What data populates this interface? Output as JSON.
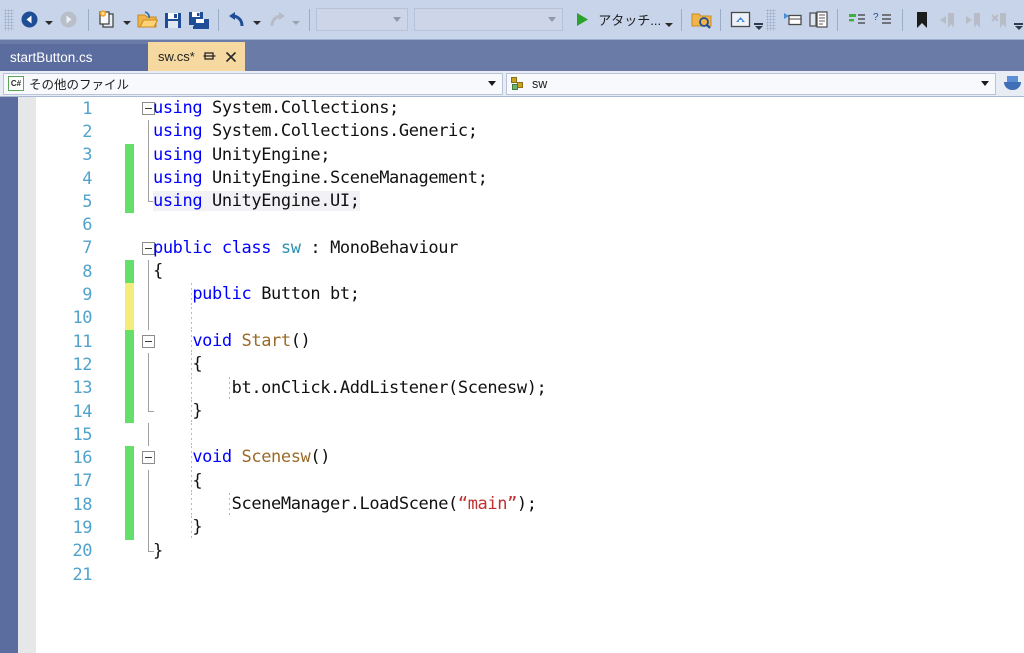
{
  "toolbar": {
    "items": [
      {
        "name": "navigate-backward-icon",
        "label": "",
        "enabled": true
      },
      {
        "name": "navigate-forward-icon",
        "label": "",
        "enabled": false
      },
      {
        "name": "new-item-icon",
        "label": "",
        "enabled": true
      },
      {
        "name": "open-file-icon",
        "label": "",
        "enabled": true
      },
      {
        "name": "save-icon",
        "label": "",
        "enabled": true
      },
      {
        "name": "save-all-icon",
        "label": "",
        "enabled": true
      },
      {
        "name": "undo-icon",
        "label": "",
        "enabled": true
      },
      {
        "name": "redo-icon",
        "label": "",
        "enabled": false
      }
    ],
    "combo_config": "",
    "combo_platform": "",
    "attach_label": "アタッチ...",
    "find_label": "",
    "bookmark_label": ""
  },
  "tabs": {
    "items": [
      {
        "label": "startButton.cs",
        "active": false,
        "dirty": false
      },
      {
        "label": "sw.cs*",
        "active": true,
        "dirty": true
      }
    ],
    "pin_tooltip": "",
    "close_tooltip": ""
  },
  "navbar": {
    "project_selector": "その他のファイル",
    "member_selector": "sw"
  },
  "editor": {
    "lines": [
      {
        "n": "1",
        "change": "none",
        "glyph": "collapse",
        "outline": "none",
        "indent_guides": [],
        "html": "<span class=\"kw\">using</span> System.Collections;"
      },
      {
        "n": "2",
        "change": "none",
        "glyph": "none",
        "outline": "line",
        "indent_guides": [],
        "html": "<span class=\"kw\">using</span> System.Collections.Generic;"
      },
      {
        "n": "3",
        "change": "green",
        "glyph": "none",
        "outline": "line",
        "indent_guides": [],
        "html": "<span class=\"kw\">using</span> UnityEngine;"
      },
      {
        "n": "4",
        "change": "green",
        "glyph": "none",
        "outline": "line",
        "indent_guides": [],
        "html": "<span class=\"kw\">using</span> UnityEngine.SceneManagement;"
      },
      {
        "n": "5",
        "change": "green",
        "glyph": "none",
        "outline": "end",
        "indent_guides": [],
        "html": "<span class=\"kw hl\">using</span><span class=\"hl\"> UnityEngine.UI;</span>"
      },
      {
        "n": "6",
        "change": "none",
        "glyph": "none",
        "outline": "none",
        "indent_guides": [],
        "html": ""
      },
      {
        "n": "7",
        "change": "none",
        "glyph": "collapse",
        "outline": "none",
        "indent_guides": [],
        "html": "<span class=\"kw\">public</span> <span class=\"kw\">class</span> <span class=\"type\">sw</span> : MonoBehaviour"
      },
      {
        "n": "8",
        "change": "green",
        "glyph": "none",
        "outline": "line",
        "indent_guides": [],
        "html": "{"
      },
      {
        "n": "9",
        "change": "yellow",
        "glyph": "none",
        "outline": "line",
        "indent_guides": [
          38
        ],
        "html": "    <span class=\"kw\">public</span> Button bt;"
      },
      {
        "n": "10",
        "change": "yellow",
        "glyph": "none",
        "outline": "line",
        "indent_guides": [
          38
        ],
        "html": ""
      },
      {
        "n": "11",
        "change": "green",
        "glyph": "collapse",
        "outline": "none",
        "indent_guides": [
          38
        ],
        "html": "    <span class=\"kw\">void</span> <span class=\"mth\">Start</span>()"
      },
      {
        "n": "12",
        "change": "green",
        "glyph": "none",
        "outline": "line",
        "indent_guides": [
          38
        ],
        "html": "    {"
      },
      {
        "n": "13",
        "change": "green",
        "glyph": "none",
        "outline": "line",
        "indent_guides": [
          38,
          76
        ],
        "html": "        bt.onClick.AddListener(Scenesw);"
      },
      {
        "n": "14",
        "change": "green",
        "glyph": "none",
        "outline": "end",
        "indent_guides": [
          38
        ],
        "html": "    }"
      },
      {
        "n": "15",
        "change": "none",
        "glyph": "none",
        "outline": "line",
        "indent_guides": [
          38
        ],
        "html": ""
      },
      {
        "n": "16",
        "change": "green",
        "glyph": "collapse",
        "outline": "none",
        "indent_guides": [
          38
        ],
        "html": "    <span class=\"kw\">void</span> <span class=\"mth\">Scenesw</span>()"
      },
      {
        "n": "17",
        "change": "green",
        "glyph": "none",
        "outline": "line",
        "indent_guides": [
          38
        ],
        "html": "    {"
      },
      {
        "n": "18",
        "change": "green",
        "glyph": "none",
        "outline": "line",
        "indent_guides": [
          38,
          76
        ],
        "html": "        SceneManager.LoadScene(<span class=\"str\">“main”</span>);"
      },
      {
        "n": "19",
        "change": "green",
        "glyph": "none",
        "outline": "line",
        "indent_guides": [
          38
        ],
        "html": "    }"
      },
      {
        "n": "20",
        "change": "none",
        "glyph": "none",
        "outline": "end",
        "indent_guides": [],
        "html": "}"
      },
      {
        "n": "21",
        "change": "none",
        "glyph": "none",
        "outline": "none",
        "indent_guides": [],
        "html": ""
      }
    ]
  },
  "colors": {
    "toolbar_bg": "#c7d4ea",
    "tabstrip_bg": "#6b7ba8",
    "tab_active_bg": "#f5d9a0",
    "tab_inactive_bg": "#5b6c9f",
    "line_number": "#51a3cc",
    "change_green": "#64e06a",
    "change_yellow": "#f5ed7a",
    "keyword": "#0000ff",
    "type": "#2b91af",
    "method": "#9a6a28",
    "string": "#c03030"
  }
}
